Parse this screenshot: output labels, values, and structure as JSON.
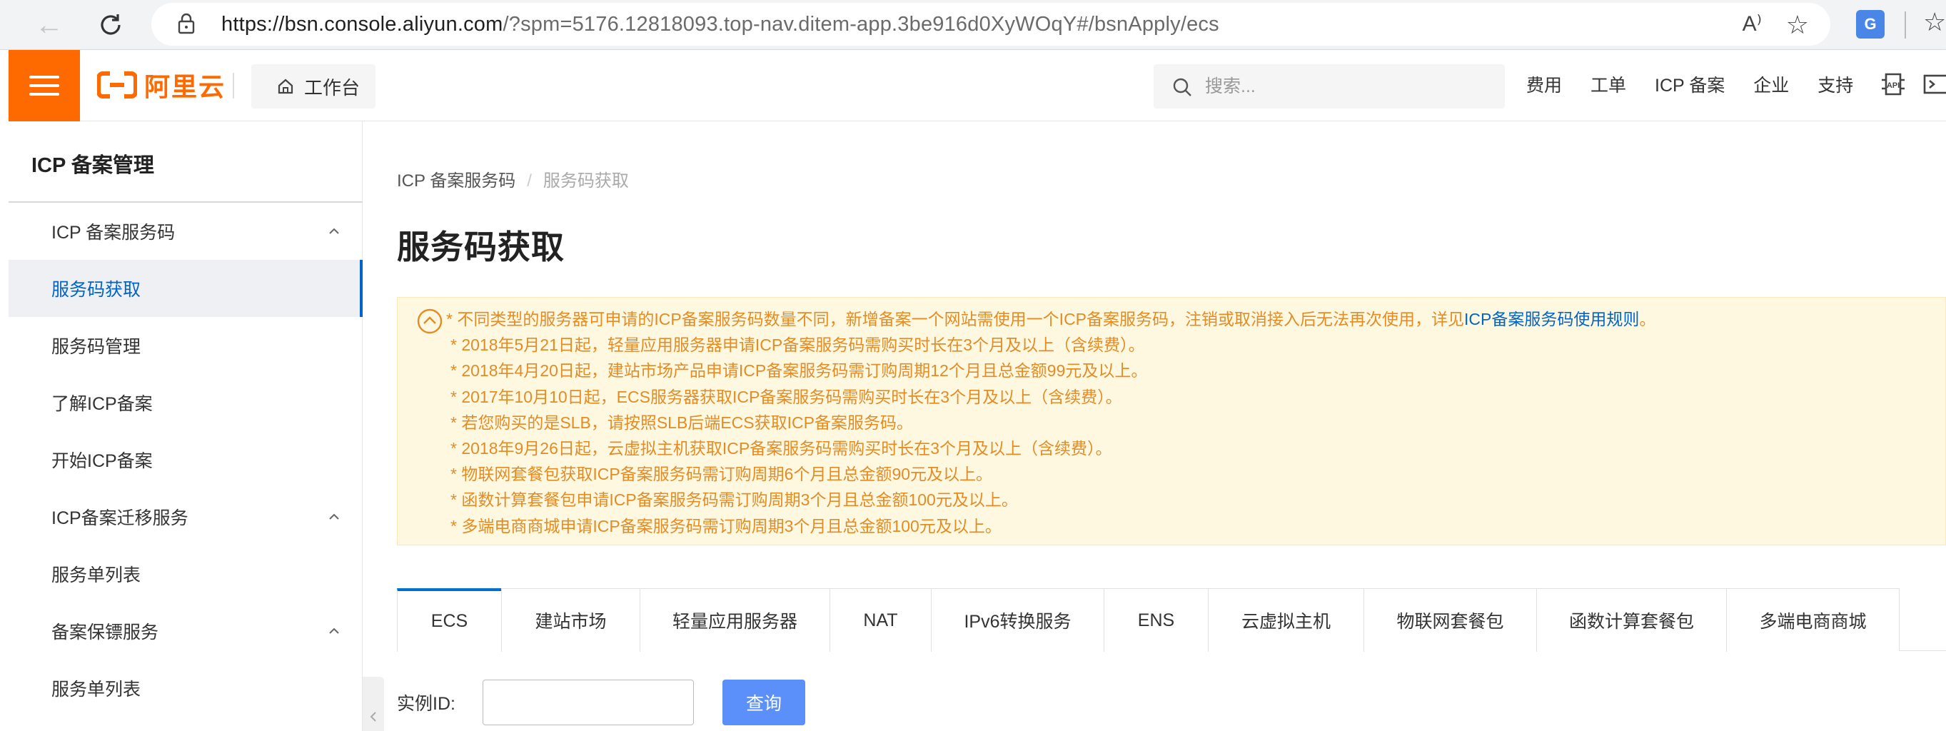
{
  "browser": {
    "url_main": "https://bsn.console.aliyun.com",
    "url_rest": "/?spm=5176.12818093.top-nav.ditem-app.3be916d0XyWOqY#/bsnApply/ecs",
    "read_aloud": "A⁾",
    "translate_badge": "G"
  },
  "topnav": {
    "logo_text": "阿里云",
    "workbench": "工作台",
    "search_placeholder": "搜索...",
    "links": [
      "费用",
      "工单",
      "ICP 备案",
      "企业",
      "支持"
    ],
    "accent": "#ff6a00"
  },
  "sidebar": {
    "title": "ICP 备案管理",
    "items": [
      {
        "label": "ICP 备案服务码",
        "group": true
      },
      {
        "label": "服务码获取",
        "active": true
      },
      {
        "label": "服务码管理"
      },
      {
        "label": "了解ICP备案"
      },
      {
        "label": "开始ICP备案"
      },
      {
        "label": "ICP备案迁移服务",
        "group": true
      },
      {
        "label": "服务单列表"
      },
      {
        "label": "备案保镖服务",
        "group": true
      },
      {
        "label": "服务单列表"
      }
    ]
  },
  "breadcrumb": {
    "parent": "ICP 备案服务码",
    "separator": "/",
    "current": "服务码获取"
  },
  "page": {
    "title": "服务码获取"
  },
  "notice": {
    "first_line": "* 不同类型的服务器可申请的ICP备案服务码数量不同，新增备案一个网站需使用一个ICP备案服务码，注销或取消接入后无法再次使用，详见",
    "first_link": "ICP备案服务码使用规则",
    "first_end": "。",
    "lines": [
      "* 2018年5月21日起，轻量应用服务器申请ICP备案服务码需购买时长在3个月及以上（含续费）。",
      "* 2018年4月20日起，建站市场产品申请ICP备案服务码需订购周期12个月且总金额99元及以上。",
      "* 2017年10月10日起，ECS服务器获取ICP备案服务码需购买时长在3个月及以上（含续费）。",
      "* 若您购买的是SLB，请按照SLB后端ECS获取ICP备案服务码。",
      "* 2018年9月26日起，云虚拟主机获取ICP备案服务码需购买时长在3个月及以上（含续费）。",
      "* 物联网套餐包获取ICP备案服务码需订购周期6个月且总金额90元及以上。",
      "* 函数计算套餐包申请ICP备案服务码需订购周期3个月且总金额100元及以上。",
      "* 多端电商商城申请ICP备案服务码需订购周期3个月且总金额100元及以上。"
    ]
  },
  "tabs": [
    {
      "label": "ECS",
      "active": true
    },
    {
      "label": "建站市场"
    },
    {
      "label": "轻量应用服务器"
    },
    {
      "label": "NAT"
    },
    {
      "label": "IPv6转换服务"
    },
    {
      "label": "ENS"
    },
    {
      "label": "云虚拟主机"
    },
    {
      "label": "物联网套餐包"
    },
    {
      "label": "函数计算套餐包"
    },
    {
      "label": "多端电商商城"
    }
  ],
  "query": {
    "label": "实例ID:",
    "input_value": "",
    "button": "查询"
  }
}
